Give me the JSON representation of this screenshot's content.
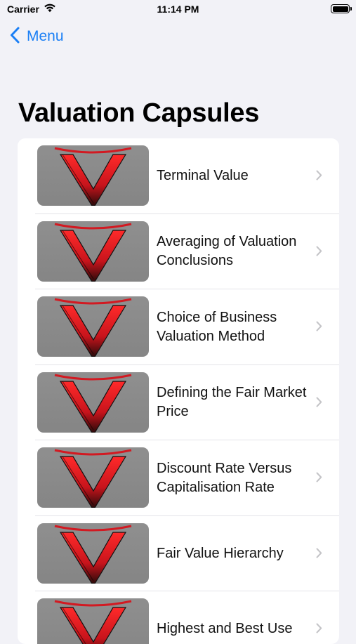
{
  "status_bar": {
    "carrier": "Carrier",
    "time": "11:14 PM",
    "wifi_icon": "wifi-icon",
    "battery_icon": "battery-icon"
  },
  "nav": {
    "back_label": "Menu",
    "back_icon": "chevron-left-icon",
    "accent_color": "#1b7ff5"
  },
  "page": {
    "title": "Valuation Capsules"
  },
  "list": {
    "thumbnail_icon": "valuation-logo-icon",
    "chevron_icon": "chevron-right-icon",
    "items": [
      {
        "label": "Terminal Value"
      },
      {
        "label": "Averaging of Valuation Conclusions"
      },
      {
        "label": "Choice of Business Valuation Method"
      },
      {
        "label": "Defining the Fair Market Price"
      },
      {
        "label": "Discount Rate Versus Capitalisation Rate"
      },
      {
        "label": "Fair Value Hierarchy"
      },
      {
        "label": "Highest and Best Use"
      }
    ]
  },
  "colors": {
    "background": "#f2f2f7",
    "card": "#ffffff",
    "logo_red": "#e5202a",
    "thumbnail_gray": "#8a8a8a"
  }
}
